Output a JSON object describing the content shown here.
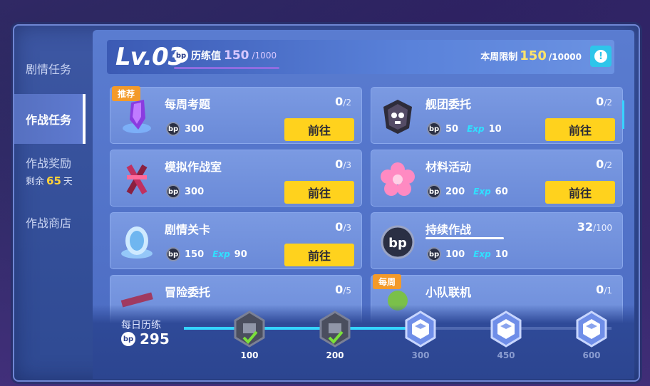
{
  "sidebar": {
    "items": [
      {
        "label": "剧情任务"
      },
      {
        "label": "作战任务",
        "active": true
      },
      {
        "label": "作战奖励",
        "sub_prefix": "剩余",
        "sub_value": "65",
        "sub_suffix": "天"
      },
      {
        "label": "作战商店"
      }
    ]
  },
  "header": {
    "level": "Lv.03",
    "exp_label": "历练值",
    "exp_value": "150",
    "exp_max": "/1000",
    "exp_progress_fraction": 0.15,
    "weekly_label": "本周限制",
    "weekly_value": "150",
    "weekly_max": "/10000",
    "info_icon": "exclamation-icon"
  },
  "tasks": [
    {
      "title": "每周考题",
      "progress": "0",
      "total": "/2",
      "bp": "300",
      "tag": "推荐",
      "button": "前往",
      "icon": "crystal-icon"
    },
    {
      "title": "舰团委托",
      "progress": "0",
      "total": "/2",
      "bp": "50",
      "exp": "10",
      "button": "前往",
      "icon": "skull-emblem-icon"
    },
    {
      "title": "模拟作战室",
      "progress": "0",
      "total": "/3",
      "bp": "300",
      "button": "前往",
      "icon": "crossed-swords-icon"
    },
    {
      "title": "材料活动",
      "progress": "0",
      "total": "/2",
      "bp": "200",
      "exp": "60",
      "button": "前往",
      "icon": "sakura-icon"
    },
    {
      "title": "剧情关卡",
      "progress": "0",
      "total": "/3",
      "bp": "150",
      "exp": "90",
      "button": "前往",
      "icon": "ice-egg-icon"
    },
    {
      "title": "持续作战",
      "progress": "32",
      "total": "/100",
      "bp": "100",
      "exp": "10",
      "icon": "bp-token-icon"
    },
    {
      "title": "冒险委托",
      "progress": "0",
      "total": "/5",
      "icon": "adventure-icon"
    },
    {
      "title": "小队联机",
      "progress": "0",
      "total": "/1",
      "tag": "每周",
      "icon": "team-icon"
    }
  ],
  "daily": {
    "label": "每日历练",
    "value": "295",
    "milestones": [
      {
        "value": "100",
        "claimed": true
      },
      {
        "value": "200",
        "claimed": true
      },
      {
        "value": "300",
        "claimed": false
      },
      {
        "value": "450",
        "claimed": false
      },
      {
        "value": "600",
        "claimed": false
      }
    ]
  },
  "colors": {
    "accent_yellow": "#ffd21d",
    "exp_cyan": "#30e0ff",
    "tag_orange": "#f39a2a",
    "panel_blue": "#5a7cd0"
  }
}
